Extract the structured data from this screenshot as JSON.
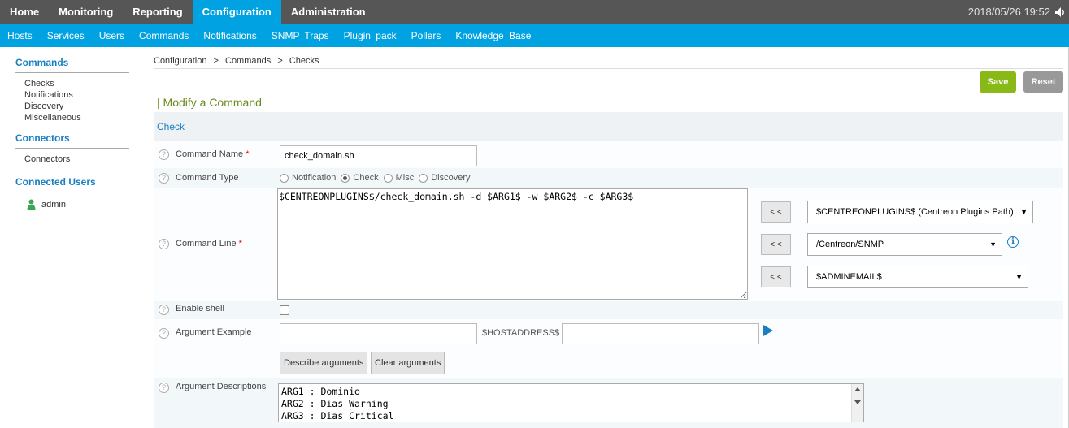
{
  "topnav": {
    "items": [
      "Home",
      "Monitoring",
      "Reporting",
      "Configuration",
      "Administration"
    ],
    "active": "Configuration",
    "datetime": "2018/05/26 19:52"
  },
  "subnav": {
    "items": [
      "Hosts",
      "Services",
      "Users",
      "Commands",
      "Notifications",
      "SNMP Traps",
      "Plugin pack",
      "Pollers",
      "Knowledge Base"
    ]
  },
  "sidebar": {
    "commands_title": "Commands",
    "commands_items": [
      "Checks",
      "Notifications",
      "Discovery",
      "Miscellaneous"
    ],
    "connectors_title": "Connectors",
    "connectors_items": [
      "Connectors"
    ],
    "users_title": "Connected Users",
    "user_name": "admin"
  },
  "breadcrumb": [
    "Configuration",
    "Commands",
    "Checks"
  ],
  "breadcrumb_sep": ">",
  "buttons": {
    "save": "Save",
    "reset": "Reset"
  },
  "form": {
    "title": "| Modify a Command",
    "section": "Check",
    "command_name_label": "Command Name",
    "command_name_value": "check_domain.sh",
    "command_type_label": "Command Type",
    "command_types": [
      "Notification",
      "Check",
      "Misc",
      "Discovery"
    ],
    "command_type_selected": "Check",
    "command_line_label": "Command Line",
    "command_line_value": "$CENTREONPLUGINS$/check_domain.sh -d $ARG1$ -w $ARG2$ -c $ARG3$",
    "insert_button": "< <",
    "macro_select_1": "$CENTREONPLUGINS$ (Centreon Plugins Path)",
    "macro_select_2": "/Centreon/SNMP",
    "macro_select_3": "$ADMINEMAIL$",
    "enable_shell_label": "Enable shell",
    "argument_example_label": "Argument Example",
    "host_address_label": "$HOSTADDRESS$",
    "describe_arguments": "Describe arguments",
    "clear_arguments": "Clear arguments",
    "argument_descriptions_label": "Argument Descriptions",
    "argument_descriptions_value": "ARG1 : Dominio\nARG2 : Dias Warning\nARG3 : Dias Critical",
    "required_mark": "*",
    "help_mark": "?"
  },
  "colors": {
    "topbar": "#565656",
    "accent": "#00a2e1",
    "save": "#88b917",
    "reset": "#999999",
    "title": "#6a8a1a",
    "link": "#1a7fc1"
  }
}
